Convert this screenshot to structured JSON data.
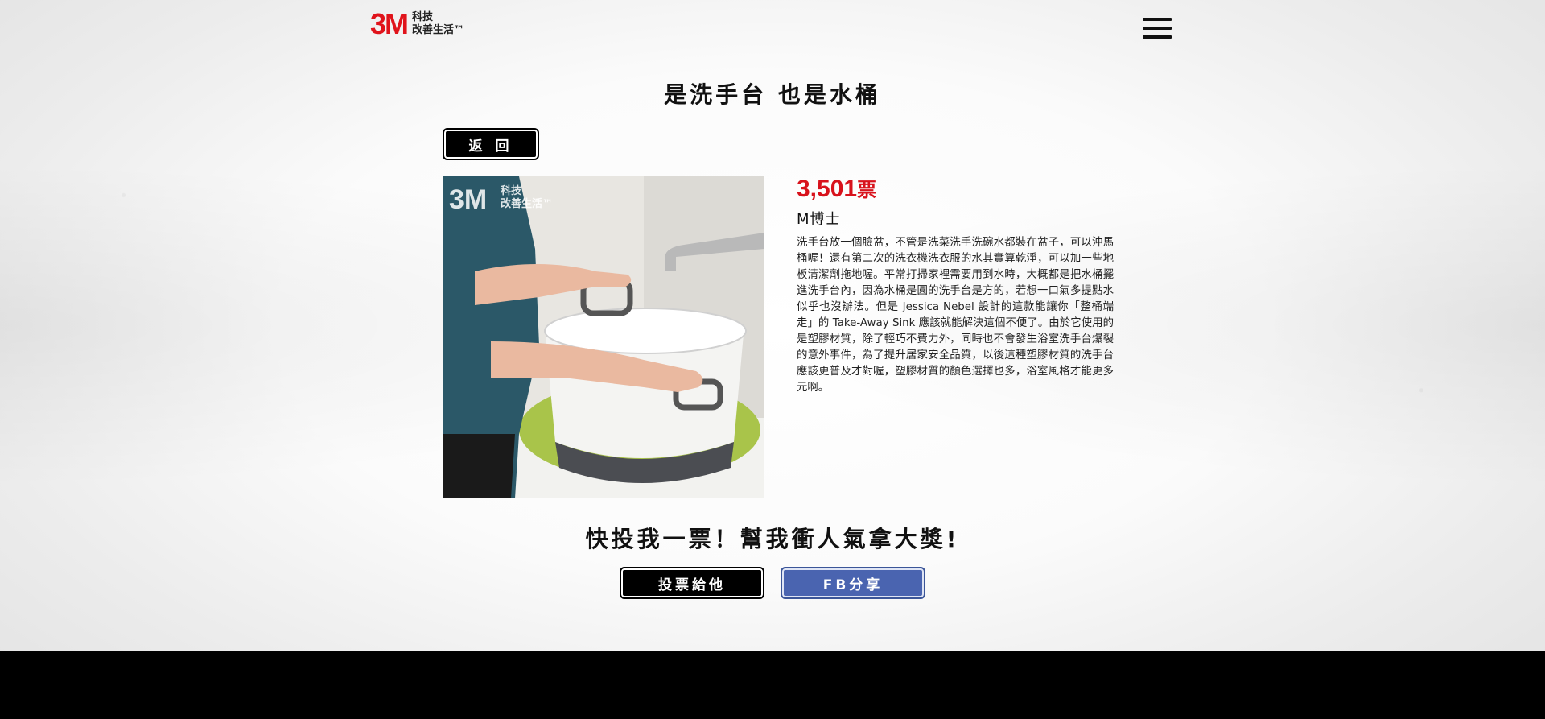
{
  "header": {
    "logo_mark": "3M",
    "logo_line1": "科技",
    "logo_line2": "改善生活™",
    "menu_icon": "hamburger-menu-icon"
  },
  "page": {
    "title": "是洗手台 也是水桶",
    "back_label": "返 回"
  },
  "entry": {
    "votes": "3,501",
    "votes_unit": "票",
    "author": "M博士",
    "watermark_mark": "3M",
    "watermark_line1": "科技",
    "watermark_line2": "改善生活™",
    "description": "洗手台放一個臉盆，不管是洗菜洗手洗碗水都裝在盆子，可以沖馬桶喔！還有第二次的洗衣機洗衣服的水其實算乾淨，可以加一些地板清潔劑拖地喔。平常打掃家裡需要用到水時，大概都是把水桶擺進洗手台內，因為水桶是圓的洗手台是方的，若想一口氣多提點水似乎也沒辦法。但是 Jessica Nebel 設計的這款能讓你「整桶端走」的 Take-Away Sink 應該就能解決這個不便了。由於它使用的是塑膠材質，除了輕巧不費力外，同時也不會發生浴室洗手台爆裂的意外事件，為了提升居家安全品質，以後這種塑膠材質的洗手台應該更普及才對喔，塑膠材質的顏色選擇也多，浴室風格才能更多元啊。"
  },
  "cta": {
    "text": "快投我一票！幫我衝人氣拿大獎!",
    "vote_label": "投票給他",
    "share_label": "FB分享"
  },
  "colors": {
    "accent_red": "#d8121c",
    "facebook_blue": "#4a64b0",
    "footer": "#000000"
  }
}
